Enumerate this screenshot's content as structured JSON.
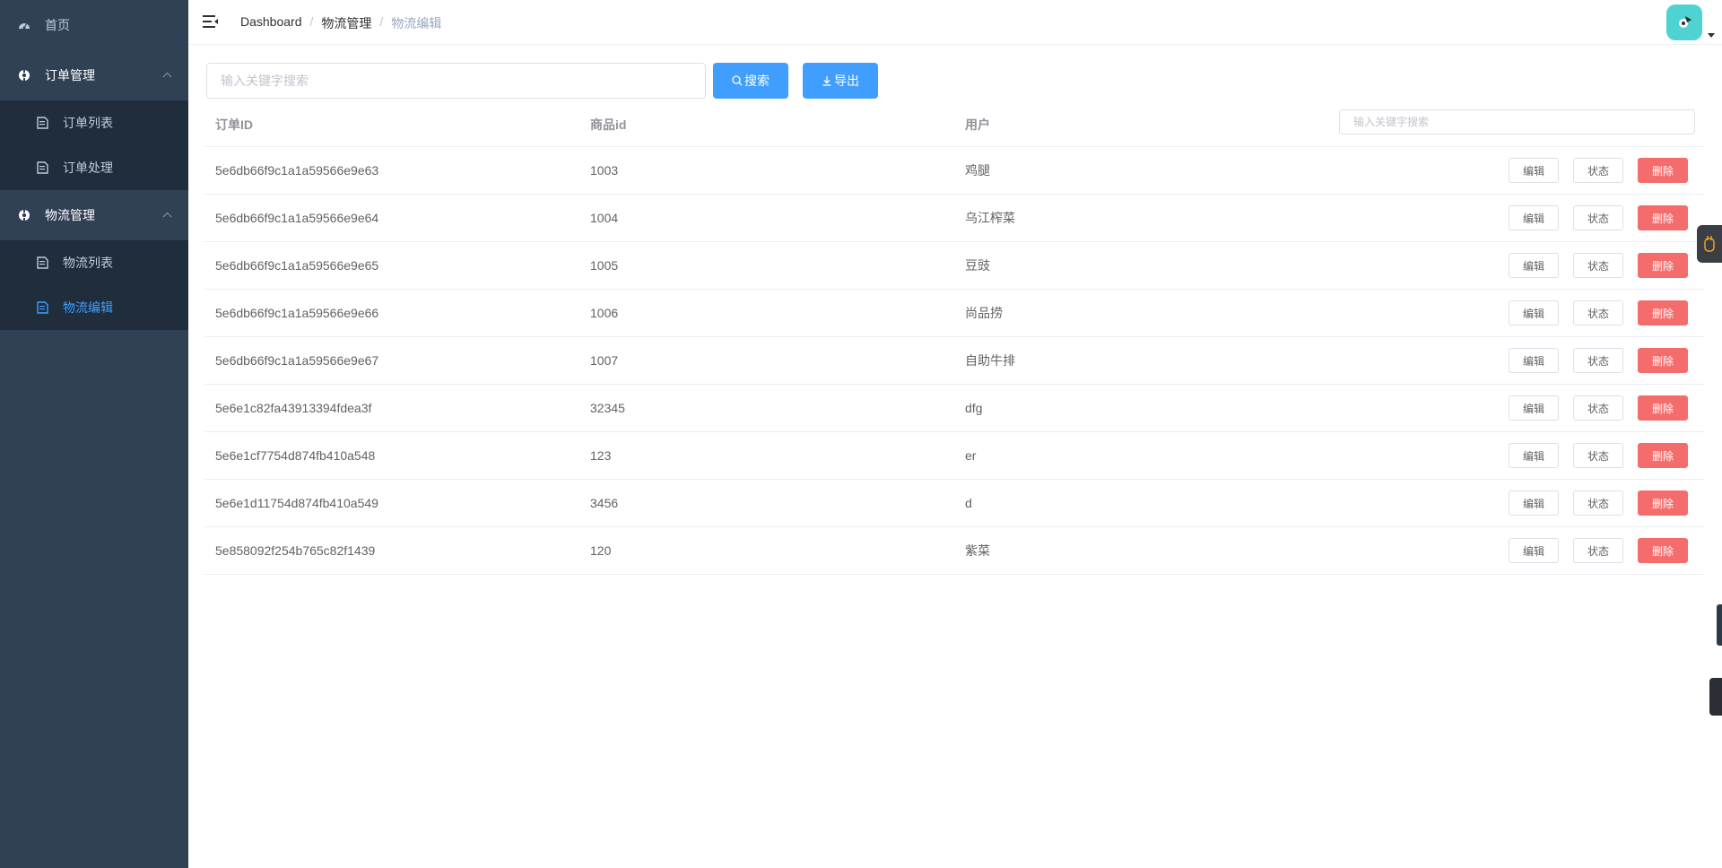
{
  "sidebar": {
    "home": "首页",
    "groups": [
      {
        "title": "订单管理",
        "items": [
          {
            "label": "订单列表"
          },
          {
            "label": "订单处理"
          }
        ]
      },
      {
        "title": "物流管理",
        "items": [
          {
            "label": "物流列表"
          },
          {
            "label": "物流编辑"
          }
        ]
      }
    ]
  },
  "breadcrumb": [
    "Dashboard",
    "物流管理",
    "物流编辑"
  ],
  "breadcrumb_separator": "/",
  "toolbar": {
    "search_placeholder": "输入关键字搜索",
    "search_label": "搜索",
    "export_label": "导出"
  },
  "table": {
    "headers": [
      "订单ID",
      "商品id",
      "用户"
    ],
    "search_placeholder": "输入关键字搜索",
    "actions": {
      "edit": "编辑",
      "status": "状态",
      "delete": "删除"
    },
    "rows": [
      [
        "5e6db66f9c1a1a59566e9e63",
        "1003",
        "鸡腿"
      ],
      [
        "5e6db66f9c1a1a59566e9e64",
        "1004",
        "乌江榨菜"
      ],
      [
        "5e6db66f9c1a1a59566e9e65",
        "1005",
        "豆豉"
      ],
      [
        "5e6db66f9c1a1a59566e9e66",
        "1006",
        "尚品捞"
      ],
      [
        "5e6db66f9c1a1a59566e9e67",
        "1007",
        "自助牛排"
      ],
      [
        "5e6e1c82fa43913394fdea3f",
        "32345",
        "dfg"
      ],
      [
        "5e6e1cf7754d874fb410a548",
        "123",
        "er"
      ],
      [
        "5e6e1d11754d874fb410a549",
        "3456",
        "d"
      ],
      [
        "5e858092f254b765c82f1439",
        "120",
        "紫菜"
      ]
    ]
  },
  "colors": {
    "sidebar_bg": "#304156",
    "submenu_bg": "#1f2d3d",
    "primary": "#409eff",
    "danger": "#f56c6c",
    "avatar_bg": "#4fd3d2"
  }
}
